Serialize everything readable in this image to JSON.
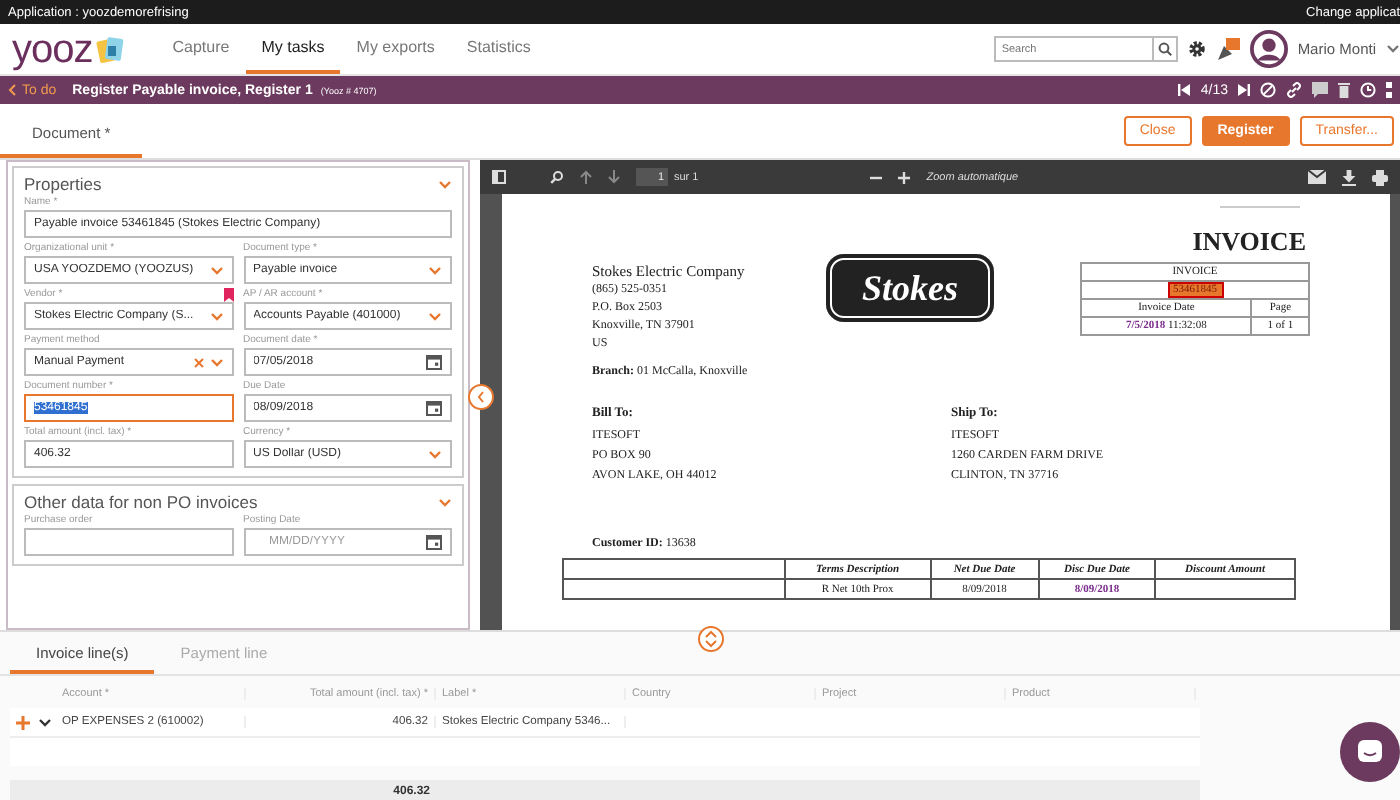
{
  "app_bar": {
    "application": "Application : yoozdemorefrising",
    "change_link": "Change applicat"
  },
  "nav": {
    "logo": "yooz",
    "tabs": [
      {
        "label": "Capture",
        "selected": false
      },
      {
        "label": "My tasks",
        "selected": true
      },
      {
        "label": "My exports",
        "selected": false
      },
      {
        "label": "Statistics",
        "selected": false
      }
    ],
    "search": {
      "placeholder": "Search"
    },
    "user": "Mario Monti"
  },
  "task_bar": {
    "back": "To do",
    "title": "Register Payable invoice, Register 1",
    "ref": "(Yooz # 4707)",
    "pager": "4/13"
  },
  "doc_tabs": [
    {
      "label": "Document *",
      "selected": true
    }
  ],
  "actions": [
    {
      "label": "Close",
      "kind": "secondary"
    },
    {
      "label": "Register",
      "kind": "primary"
    },
    {
      "label": "Transfer...",
      "kind": "secondary"
    }
  ],
  "sections": [
    {
      "title": "Properties",
      "fields": [
        {
          "label": "Name *",
          "value": "Payable invoice 53461845 (Stokes Electric Company)",
          "kind": "text",
          "wide": true,
          "focused": false
        },
        {
          "label": "Organizational unit *",
          "value": "USA YOOZDEMO (YOOZUS)",
          "kind": "select",
          "focused": false
        },
        {
          "label": "Document type *",
          "value": "Payable invoice",
          "kind": "select",
          "focused": false
        },
        {
          "label": "Vendor *",
          "value": "Stokes Electric Company (S...",
          "kind": "select",
          "flagged": true,
          "focused": false
        },
        {
          "label": "AP / AR account *",
          "value": "Accounts Payable (401000)",
          "kind": "select",
          "focused": false
        },
        {
          "label": "Payment method",
          "value": "Manual Payment",
          "kind": "select",
          "clearable": true,
          "focused": false
        },
        {
          "label": "Document date *",
          "value": "07/05/2018",
          "kind": "date",
          "focused": false
        },
        {
          "label": "Document number *",
          "value": "53461845",
          "kind": "text",
          "focused": true
        },
        {
          "label": "Due Date",
          "value": "08/09/2018",
          "kind": "date",
          "focused": false
        },
        {
          "label": "Total amount (incl. tax) *",
          "value": "406.32",
          "kind": "text",
          "focused": false
        },
        {
          "label": "Currency *",
          "value": "US Dollar (USD)",
          "kind": "select",
          "focused": false
        }
      ]
    },
    {
      "title": "Other data for non PO invoices",
      "fields": [
        {
          "label": "Purchase order",
          "kind": "text",
          "focused": false
        },
        {
          "label": "Posting Date",
          "placeholder": "MM/DD/YYYY",
          "kind": "date",
          "focused": false
        }
      ]
    }
  ],
  "viewer": {
    "page": "1",
    "page_count": "sur 1",
    "zoom": "Zoom automatique"
  },
  "document": {
    "title": "INVOICE",
    "company_lines": [
      "Stokes Electric Company",
      "(865) 525-0351",
      "P.O. Box 2503",
      "Knoxville, TN 37901",
      "US"
    ],
    "branch": "**Branch:** 01  McCalla, Knoxville",
    "logo": "Stokes",
    "invoice_box": {
      "heading": "INVOICE",
      "number": "53461845",
      "number_highlighted": true,
      "date_label": "Invoice Date",
      "page_label": "Page",
      "date": "7/5/2018",
      "date_highlighted": true,
      "time": "11:32:08",
      "page": "1 of 1"
    },
    "bill_to": {
      "heading": "Bill To:",
      "lines": [
        "ITESOFT",
        "PO BOX 90",
        "AVON LAKE, OH 44012"
      ]
    },
    "ship_to": {
      "heading": "Ship To:",
      "lines": [
        "ITESOFT",
        "1260 CARDEN FARM DRIVE",
        "CLINTON, TN 37716"
      ]
    },
    "customer_id": "**Customer ID:** 13638",
    "terms_table": {
      "columns": [
        "Terms Description",
        "Net Due Date",
        "Disc Due Date",
        "Discount Amount"
      ],
      "rows": [
        [
          {
            "text": "R Net 10th Prox",
            "highlighted": false
          },
          {
            "text": "8/09/2018",
            "highlighted": false
          },
          {
            "text": "8/09/2018",
            "highlighted": true
          }
        ]
      ]
    }
  },
  "lines_tabs": [
    {
      "label": "Invoice line(s)",
      "selected": true
    },
    {
      "label": "Payment line",
      "selected": false
    }
  ],
  "lines_table": {
    "columns": [
      "Account *",
      "Total amount (incl. tax) *",
      "Label *",
      "Country",
      "Project",
      "Product"
    ],
    "rows": [
      {
        "cells": [
          "OP EXPENSES 2 (610002)",
          "406.32",
          "Stokes Electric Company 5346..."
        ]
      }
    ],
    "total": "406.32"
  }
}
